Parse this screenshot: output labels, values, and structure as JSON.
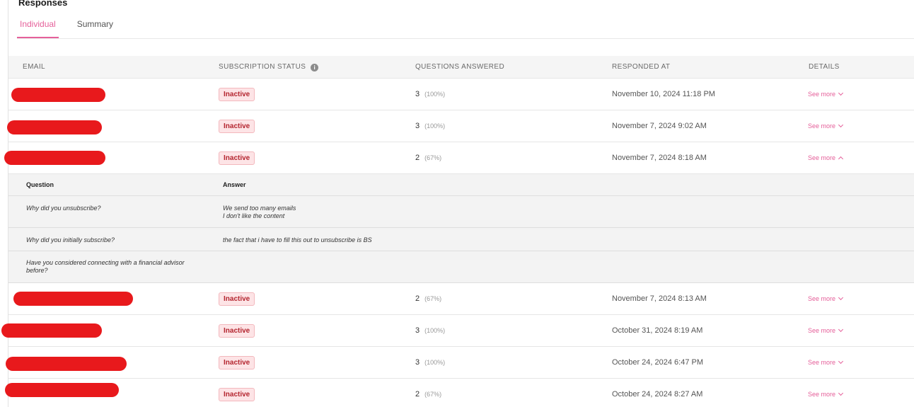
{
  "page": {
    "title": "Responses"
  },
  "tabs": [
    {
      "label": "Individual",
      "active": true
    },
    {
      "label": "Summary",
      "active": false
    }
  ],
  "columns": {
    "email": "EMAIL",
    "subscription_status": "SUBSCRIPTION STATUS",
    "questions_answered": "QUESTIONS ANSWERED",
    "responded_at": "RESPONDED AT",
    "details": "DETAILS"
  },
  "info_icon": {
    "glyph": "i"
  },
  "see_more_label": "See more",
  "rows": [
    {
      "status": "Inactive",
      "answered": "3",
      "percent": "(100%)",
      "responded_at": "November 10, 2024 11:18 PM",
      "expanded": false
    },
    {
      "status": "Inactive",
      "answered": "3",
      "percent": "(100%)",
      "responded_at": "November 7, 2024 9:02 AM",
      "expanded": false
    },
    {
      "status": "Inactive",
      "answered": "2",
      "percent": "(67%)",
      "responded_at": "November 7, 2024 8:18 AM",
      "expanded": true
    },
    {
      "status": "Inactive",
      "answered": "2",
      "percent": "(67%)",
      "responded_at": "November 7, 2024 8:13 AM",
      "expanded": false
    },
    {
      "status": "Inactive",
      "answered": "3",
      "percent": "(100%)",
      "responded_at": "October 31, 2024 8:19 AM",
      "expanded": false
    },
    {
      "status": "Inactive",
      "answered": "3",
      "percent": "(100%)",
      "responded_at": "October 24, 2024 6:47 PM",
      "expanded": false
    },
    {
      "status": "Inactive",
      "answered": "2",
      "percent": "(67%)",
      "responded_at": "October 24, 2024 8:27 AM",
      "expanded": false
    }
  ],
  "details": {
    "question_header": "Question",
    "answer_header": "Answer",
    "items": [
      {
        "question": "Why did you unsubscribe?",
        "answer_line1": "We send too many emails",
        "answer_line2": "I don't like the content"
      },
      {
        "question": "Why did you initially subscribe?",
        "answer_line1": "the fact that i have to fill this out to unsubscribe is BS",
        "answer_line2": ""
      },
      {
        "question": "Have you considered connecting with a financial advisor before?",
        "answer_line1": "",
        "answer_line2": ""
      }
    ]
  },
  "colors": {
    "accent": "#e5609a",
    "redaction": "#e8191c",
    "badge_text": "#b4252f",
    "badge_bg": "#fde4e6"
  }
}
